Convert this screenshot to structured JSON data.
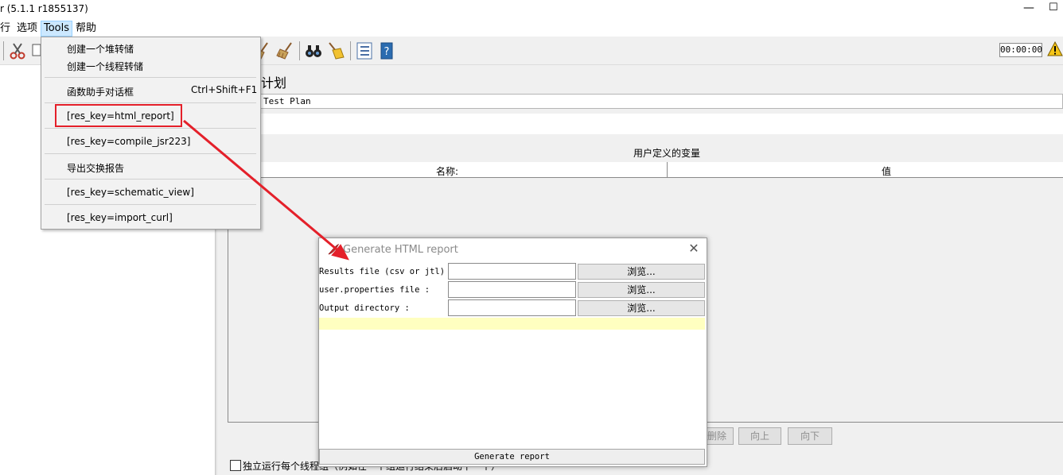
{
  "window": {
    "title": "r (5.1.1 r1855137)",
    "minimize_glyph": "—",
    "maximize_glyph": "☐"
  },
  "menubar": {
    "items": [
      "行",
      "选项",
      "Tools",
      "帮助"
    ]
  },
  "toolbar": {
    "timer": "00:00:00",
    "icons": [
      "cut-icon",
      "copy-icon",
      "broom-icon",
      "broom-icon",
      "binoculars-icon",
      "broom-icon",
      "list-icon",
      "help-book-icon",
      "warning-icon"
    ]
  },
  "tools_menu": {
    "items": [
      {
        "label": "创建一个堆转储"
      },
      {
        "label": "创建一个线程转储"
      },
      {
        "label": "函数助手对话框",
        "shortcut": "Ctrl+Shift+F1"
      },
      {
        "label": "[res_key=html_report]"
      },
      {
        "label": "[res_key=compile_jsr223]"
      },
      {
        "label": "导出交换报告"
      },
      {
        "label": "[res_key=schematic_view]"
      },
      {
        "label": "[res_key=import_curl]"
      }
    ]
  },
  "test_plan": {
    "title_fragment": "计划",
    "name_value": "Test Plan",
    "vars_heading": "用户定义的变量",
    "col_name": "名称:",
    "col_value": "值",
    "buttons": {
      "delete": "删除",
      "up": "向上",
      "down": "向下"
    },
    "independent_checkbox_label": "独立运行每个线程组（例如在一个组运行结束后启动下一个）"
  },
  "dialog": {
    "title": "Generate HTML report",
    "rows": [
      {
        "label": "Results file (csv or jtl) :",
        "browse": "浏览..."
      },
      {
        "label": "user.properties file :",
        "browse": "浏览..."
      },
      {
        "label": "Output directory :",
        "browse": "浏览..."
      }
    ],
    "generate_button": "Generate report",
    "close_glyph": "✕"
  },
  "colors": {
    "annotation_red": "#e4202a",
    "menu_highlight": "#cce8ff",
    "status_yellow": "#ffffc0"
  }
}
